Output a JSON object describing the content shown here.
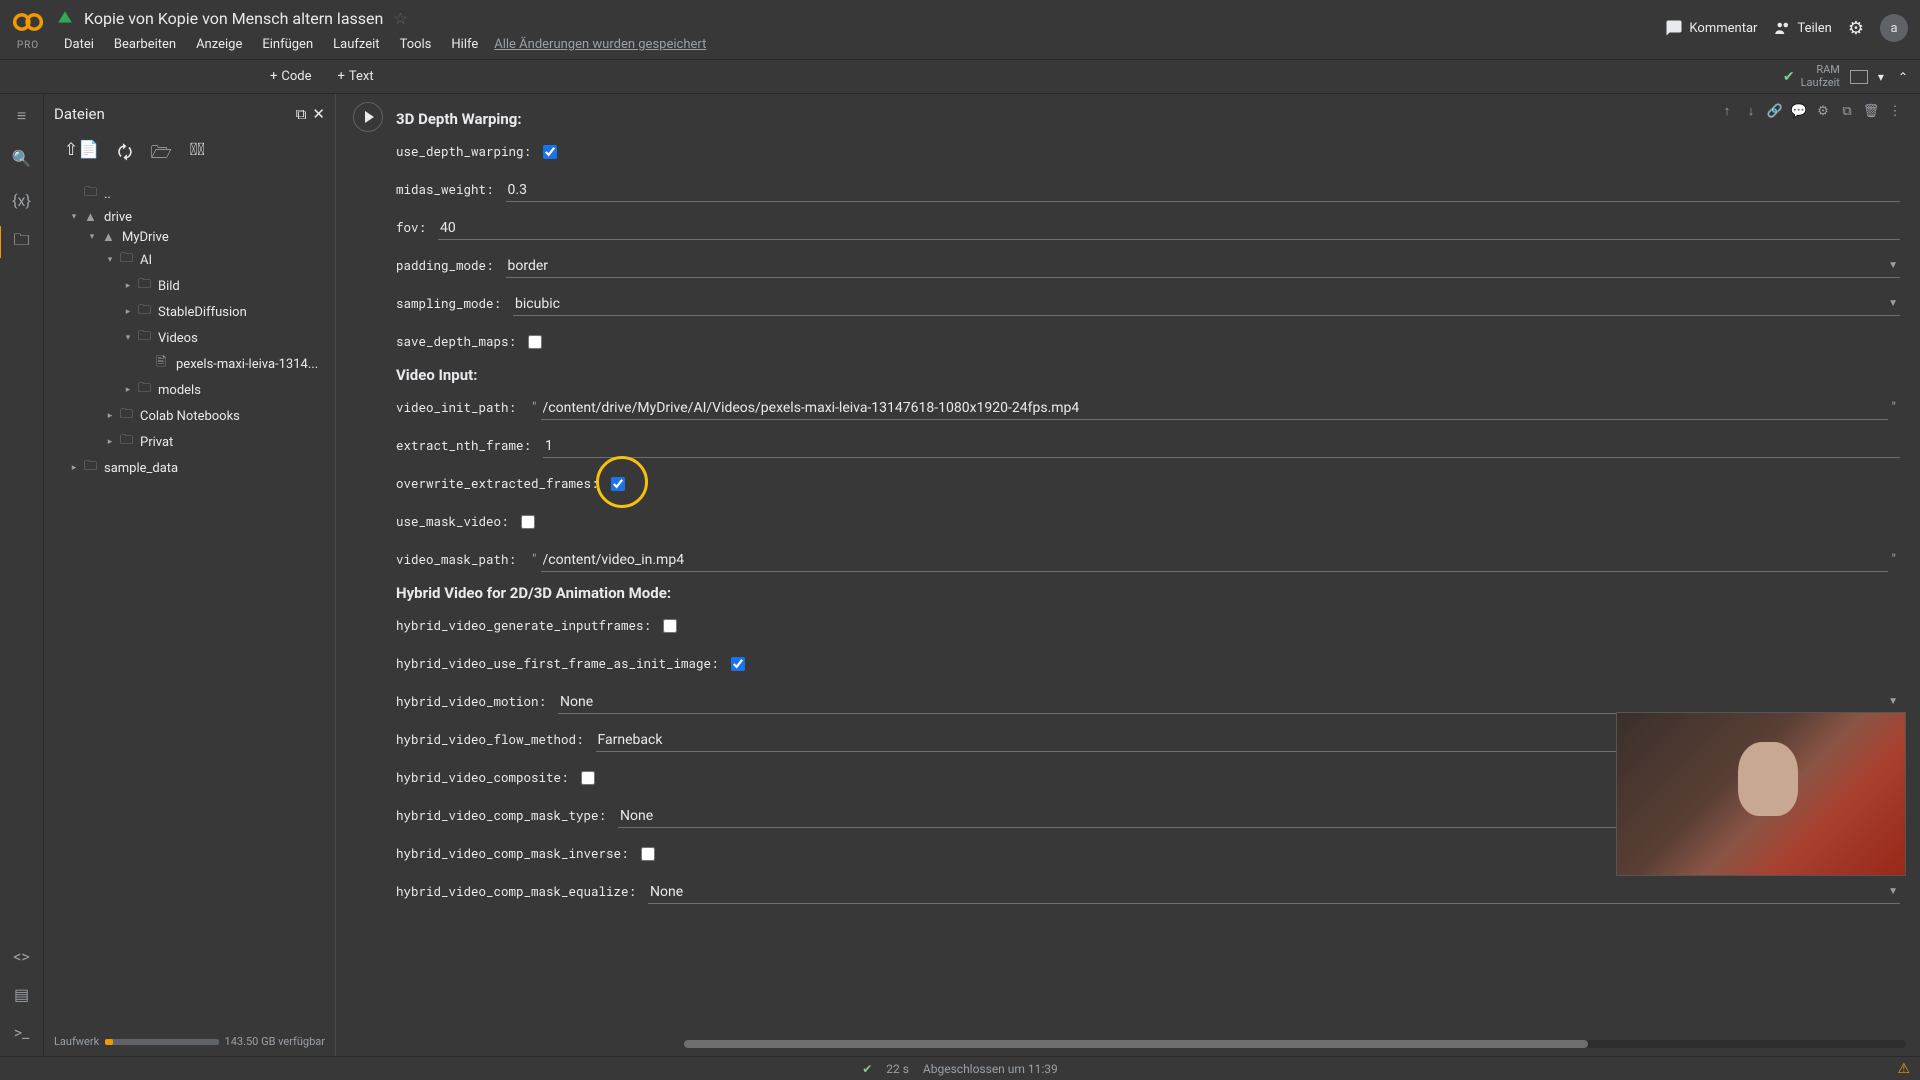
{
  "header": {
    "pro": "PRO",
    "title": "Kopie von Kopie von Mensch altern lassen",
    "menus": [
      "Datei",
      "Bearbeiten",
      "Anzeige",
      "Einfügen",
      "Laufzeit",
      "Tools",
      "Hilfe"
    ],
    "save_status": "Alle Änderungen wurden gespeichert",
    "comment": "Kommentar",
    "share": "Teilen",
    "avatar": "a"
  },
  "toolbar": {
    "code": "Code",
    "text": "Text",
    "ram": "RAM",
    "runtime": "Laufzeit"
  },
  "sidebar": {
    "title": "Dateien",
    "storage_label": "Laufwerk",
    "storage_free": "143.50 GB verfügbar",
    "tree": {
      "up": "..",
      "drive": "drive",
      "mydrive": "MyDrive",
      "ai": "AI",
      "bild": "Bild",
      "sd": "StableDiffusion",
      "videos": "Videos",
      "video_file": "pexels-maxi-leiva-1314...",
      "models": "models",
      "colab": "Colab Notebooks",
      "privat": "Privat",
      "sample": "sample_data"
    }
  },
  "cell": {
    "sec1": "3D Depth Warping:",
    "use_depth_warping": "use_depth_warping:",
    "midas_weight_l": "midas_weight:",
    "midas_weight_v": "0.3",
    "fov_l": "fov:",
    "fov_v": "40",
    "padding_mode_l": "padding_mode:",
    "padding_mode_v": "border",
    "sampling_mode_l": "sampling_mode:",
    "sampling_mode_v": "bicubic",
    "save_depth_maps_l": "save_depth_maps:",
    "sec2": "Video Input:",
    "video_init_path_l": "video_init_path:",
    "video_init_path_v": "/content/drive/MyDrive/AI/Videos/pexels-maxi-leiva-13147618-1080x1920-24fps.mp4",
    "extract_nth_frame_l": "extract_nth_frame:",
    "extract_nth_frame_v": "1",
    "overwrite_extracted_frames_l": "overwrite_extracted_frames:",
    "use_mask_video_l": "use_mask_video:",
    "video_mask_path_l": "video_mask_path:",
    "video_mask_path_v": "/content/video_in.mp4",
    "sec3": "Hybrid Video for 2D/3D Animation Mode:",
    "hv_gen_l": "hybrid_video_generate_inputframes:",
    "hv_first_l": "hybrid_video_use_first_frame_as_init_image:",
    "hv_motion_l": "hybrid_video_motion:",
    "hv_motion_v": "None",
    "hv_flow_l": "hybrid_video_flow_method:",
    "hv_flow_v": "Farneback",
    "hv_comp_l": "hybrid_video_composite:",
    "hv_mask_type_l": "hybrid_video_comp_mask_type:",
    "hv_mask_type_v": "None",
    "hv_mask_inv_l": "hybrid_video_comp_mask_inverse:",
    "hv_mask_eq_l": "hybrid_video_comp_mask_equalize:",
    "hv_mask_eq_v": "None"
  },
  "status": {
    "time": "22 s",
    "done": "Abgeschlossen um 11:39"
  }
}
